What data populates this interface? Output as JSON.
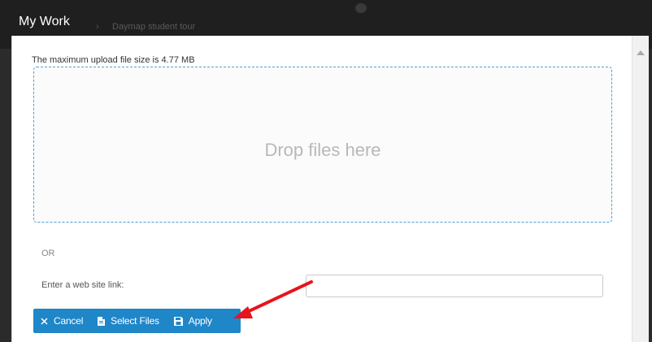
{
  "background": {
    "breadcrumb": "Daymap student tour"
  },
  "modal": {
    "title": "My Work",
    "upload_info": "The maximum upload file size is 4.77 MB",
    "drop_zone_text": "Drop files here",
    "or_text": "OR",
    "link_label": "Enter a web site link:",
    "link_value": "",
    "buttons": {
      "cancel": "Cancel",
      "select_files": "Select Files",
      "apply": "Apply"
    },
    "icons": {
      "cancel": "close-icon",
      "select_files": "file-icon",
      "apply": "save-icon"
    }
  },
  "colors": {
    "accent": "#1f86c8",
    "annotation": "#e8141c",
    "drop_border": "#4aa3d8"
  }
}
